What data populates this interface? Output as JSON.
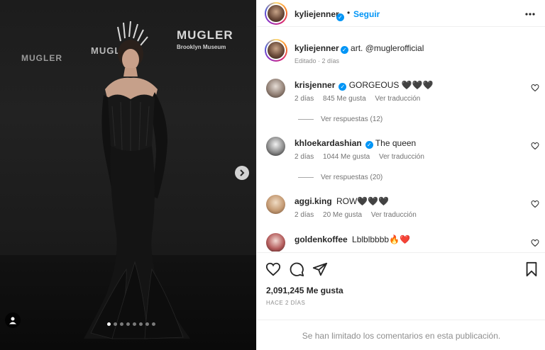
{
  "post": {
    "brand_left": "MUGLER",
    "brand_middle": "MUGLER",
    "brand_right": "MUGLER",
    "brand_right_sub": "Brooklyn Museum",
    "carousel": {
      "total": 8,
      "active": 0
    }
  },
  "header": {
    "username": "kyliejenner",
    "separator": "•",
    "follow_label": "Seguir",
    "more_label": "•••"
  },
  "caption": {
    "username": "kyliejenner",
    "text": "art. @muglerofficial",
    "meta": "Editado · 2 días"
  },
  "comments": [
    {
      "username": "krisjenner",
      "text": "GORGEOUS 🖤🖤🖤",
      "time": "2 días",
      "likes": "845 Me gusta",
      "translate": "Ver traducción",
      "replies": "Ver respuestas (12)"
    },
    {
      "username": "khloekardashian",
      "text": "The queen",
      "time": "2 días",
      "likes": "1044 Me gusta",
      "translate": "Ver traducción",
      "replies": "Ver respuestas (20)"
    },
    {
      "username": "aggi.king",
      "text": "ROW🖤🖤🖤",
      "time": "2 días",
      "likes": "20 Me gusta",
      "translate": "Ver traducción",
      "replies": ""
    },
    {
      "username": "goldenkoffee",
      "text": "Lblblbbbb🔥❤️",
      "time": "",
      "likes": "",
      "translate": "",
      "replies": ""
    }
  ],
  "actions": {
    "likes_count": "2,091,245 Me gusta",
    "time_ago": "HACE 2 DÍAS",
    "limited_comments": "Se han limitado los comentarios en esta publicación."
  },
  "colors": {
    "accent": "#0095f6",
    "text": "#262626",
    "muted": "#8e8e8e",
    "border": "#efefef"
  }
}
